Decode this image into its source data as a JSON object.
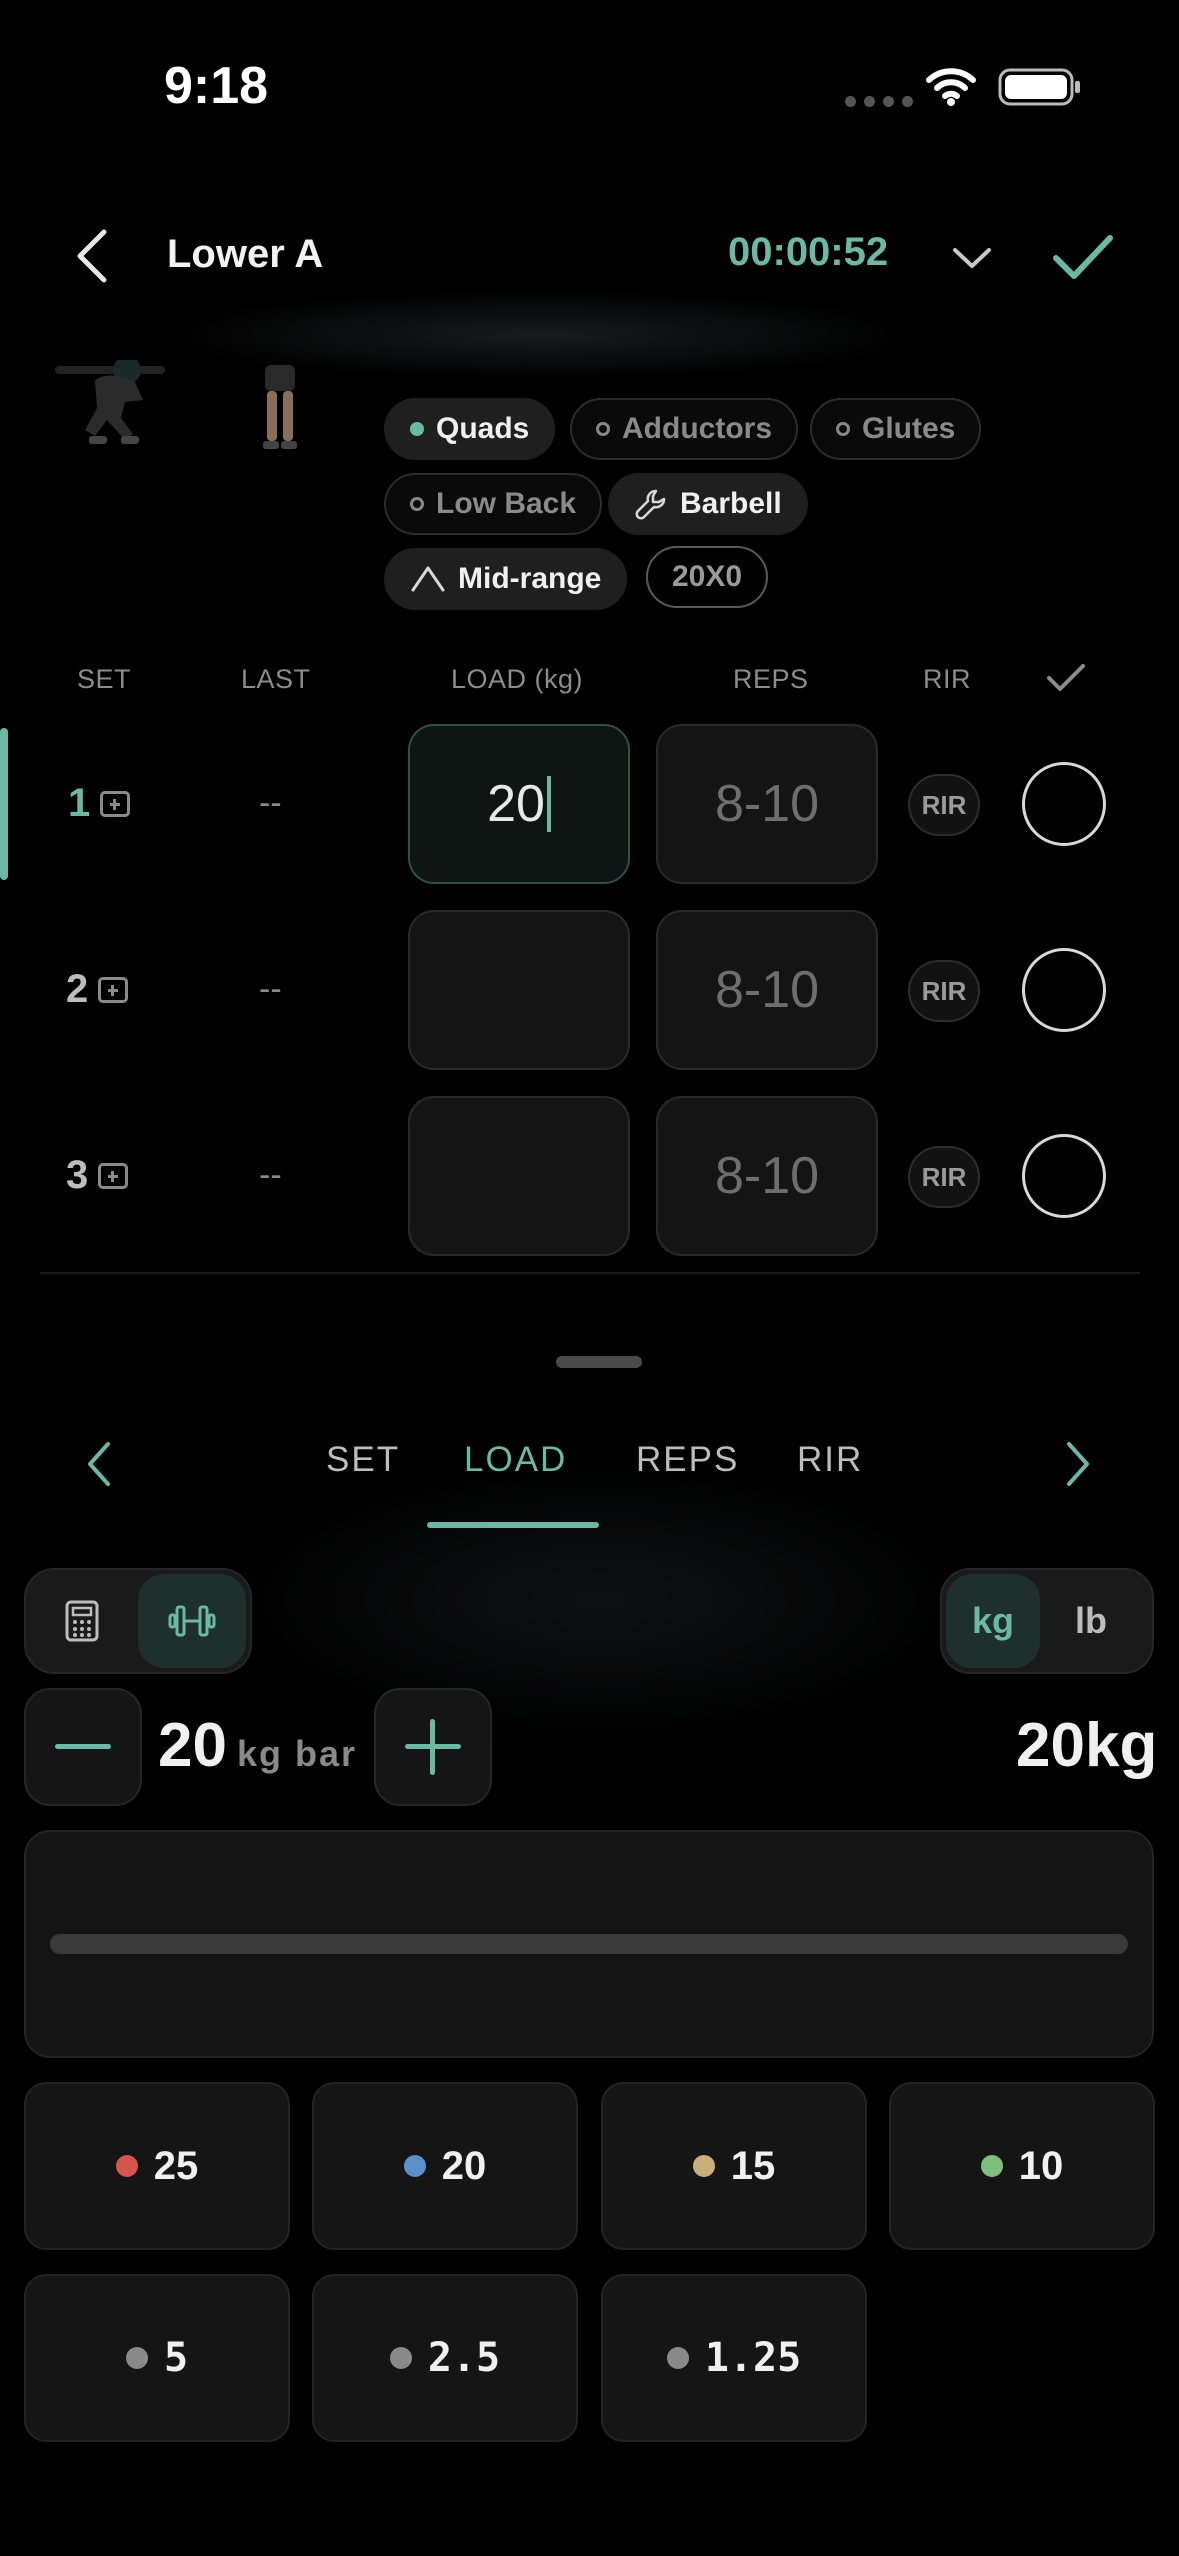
{
  "status": {
    "time": "9:18"
  },
  "header": {
    "title": "Lower A",
    "timer": "00:00:52"
  },
  "chips": [
    {
      "label": "Quads",
      "icon": "dot-filled"
    },
    {
      "label": "Adductors",
      "icon": "dot-outline"
    },
    {
      "label": "Glutes",
      "icon": "dot-outline"
    },
    {
      "label": "Low Back",
      "icon": "dot-outline"
    },
    {
      "label": "Barbell",
      "icon": "wrench-icon"
    },
    {
      "label": "Mid-range",
      "icon": "range-curve-icon"
    },
    {
      "label": "20X0",
      "icon": ""
    }
  ],
  "table": {
    "headers": {
      "set": "SET",
      "last": "LAST",
      "load": "LOAD (kg)",
      "reps": "REPS",
      "rir": "RIR"
    },
    "rows": [
      {
        "set": "1",
        "last": "--",
        "load": "20",
        "reps_placeholder": "8-10",
        "rir": "RIR",
        "active": true
      },
      {
        "set": "2",
        "last": "--",
        "load": "",
        "reps_placeholder": "8-10",
        "rir": "RIR",
        "active": false
      },
      {
        "set": "3",
        "last": "--",
        "load": "",
        "reps_placeholder": "8-10",
        "rir": "RIR",
        "active": false
      }
    ]
  },
  "tabs": [
    "SET",
    "LOAD",
    "REPS",
    "RIR"
  ],
  "active_tab": "LOAD",
  "units": {
    "kg": "kg",
    "lb": "lb",
    "selected": "kg"
  },
  "bar": {
    "value": "20",
    "unit": "kg bar",
    "total": "20kg"
  },
  "plates": [
    {
      "value": "25",
      "color": "#d9534f"
    },
    {
      "value": "20",
      "color": "#5b8fc9"
    },
    {
      "value": "15",
      "color": "#c9b07a"
    },
    {
      "value": "10",
      "color": "#7ebf7e"
    },
    {
      "value": "5",
      "color": "#8a8a8a"
    },
    {
      "value": "2.5",
      "color": "#8a8a8a"
    },
    {
      "value": "1.25",
      "color": "#8a8a8a"
    }
  ],
  "colors": {
    "accent": "#6bb9a4",
    "background": "#000000"
  }
}
